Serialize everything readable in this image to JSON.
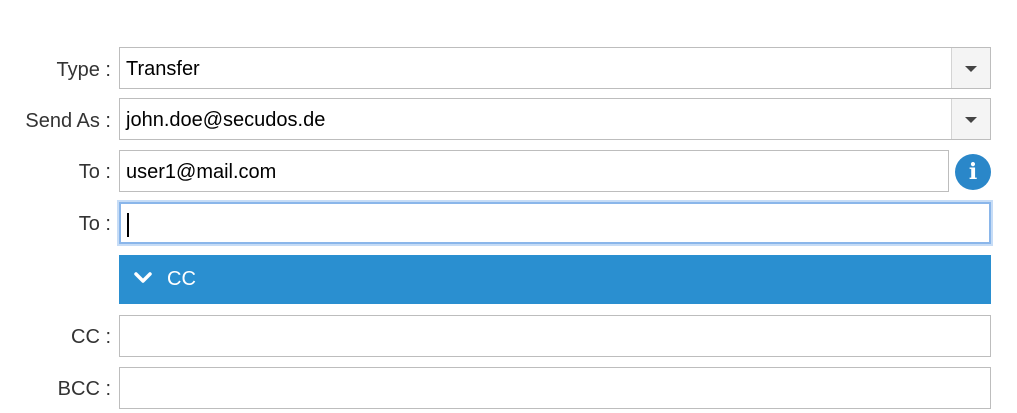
{
  "type": {
    "label": "Type :",
    "value": "Transfer"
  },
  "send_as": {
    "label": "Send As :",
    "value": "john.doe@secudos.de"
  },
  "to_1": {
    "label": "To :",
    "value": "user1@mail.com",
    "info_icon": "i"
  },
  "to_2": {
    "label": "To :",
    "value": ""
  },
  "cc_section": {
    "label": "CC",
    "expanded": true,
    "color": "#2a8fd0"
  },
  "cc": {
    "label": "CC :",
    "value": ""
  },
  "bcc": {
    "label": "BCC :",
    "value": ""
  },
  "colors": {
    "accent": "#2a8fd0",
    "focus_border": "#8ab6ea"
  }
}
